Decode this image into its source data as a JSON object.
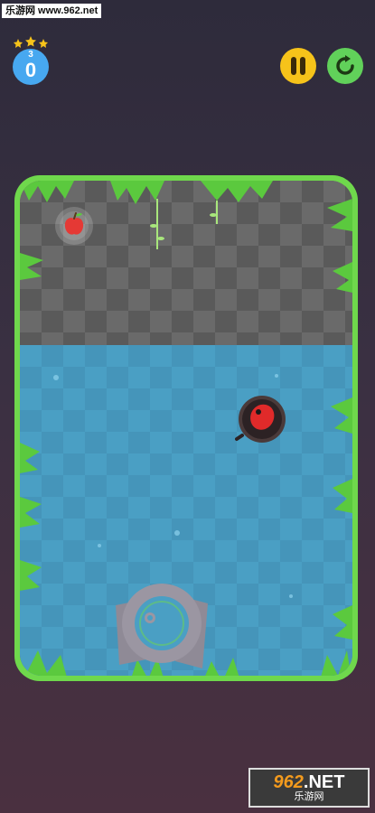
{
  "watermark_top": {
    "text": "乐游网 www.962.net"
  },
  "level": {
    "stars_count": 3,
    "small_label": "3",
    "big_label": "0"
  },
  "controls": {
    "pause_icon": "pause-icon",
    "restart_icon": "restart-icon"
  },
  "colors": {
    "pause": "#f6c31a",
    "restart": "#61d15a",
    "level_badge": "#47a8f0",
    "water": "#4a9fc4",
    "grass": "#6fd84c",
    "apple": "#e53935",
    "player": "#e02a2a"
  },
  "watermark_bottom": {
    "number": "962",
    "suffix": ".NET",
    "sub": "乐游网"
  }
}
